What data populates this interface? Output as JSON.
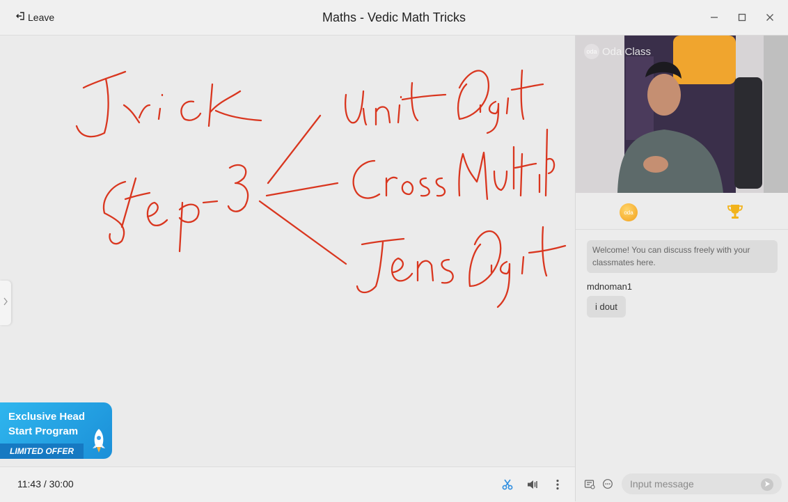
{
  "titlebar": {
    "leave_label": "Leave",
    "title": "Maths - Vedic Math Tricks",
    "icons": [
      "leave-icon",
      "minimize-icon",
      "maximize-icon",
      "close-icon"
    ]
  },
  "whiteboard": {
    "handwriting": [
      "Trick",
      "Step-3",
      "Unit Digit",
      "Cross Multip",
      "Tens Digit"
    ],
    "ink_color": "#d9361f"
  },
  "promo": {
    "line1": "Exclusive Head",
    "line2": "Start Program",
    "offer": "LIMITED OFFER",
    "colors": {
      "bg": "#2fb6ee",
      "band": "#1679c2"
    }
  },
  "controls": {
    "time_elapsed": "11:43",
    "time_separator": "/",
    "time_total": "30:00",
    "icons": [
      "scissors-icon",
      "volume-icon",
      "more-vertical-icon"
    ],
    "accent": "#2e8ee0"
  },
  "video": {
    "watermark": "Oda Class",
    "logo_badge": "oda"
  },
  "panel_tabs": {
    "coin_label": "oda",
    "icons": [
      "coin-icon",
      "trophy-icon"
    ],
    "trophy_color": "#f2b31b"
  },
  "chat": {
    "welcome": "Welcome! You can discuss freely with your classmates here.",
    "messages": [
      {
        "user": "mdnoman1",
        "text": "i dout"
      }
    ]
  },
  "chatbar": {
    "placeholder": "Input message",
    "icons": [
      "attendance-icon",
      "emoji-chat-icon",
      "send-icon"
    ]
  }
}
